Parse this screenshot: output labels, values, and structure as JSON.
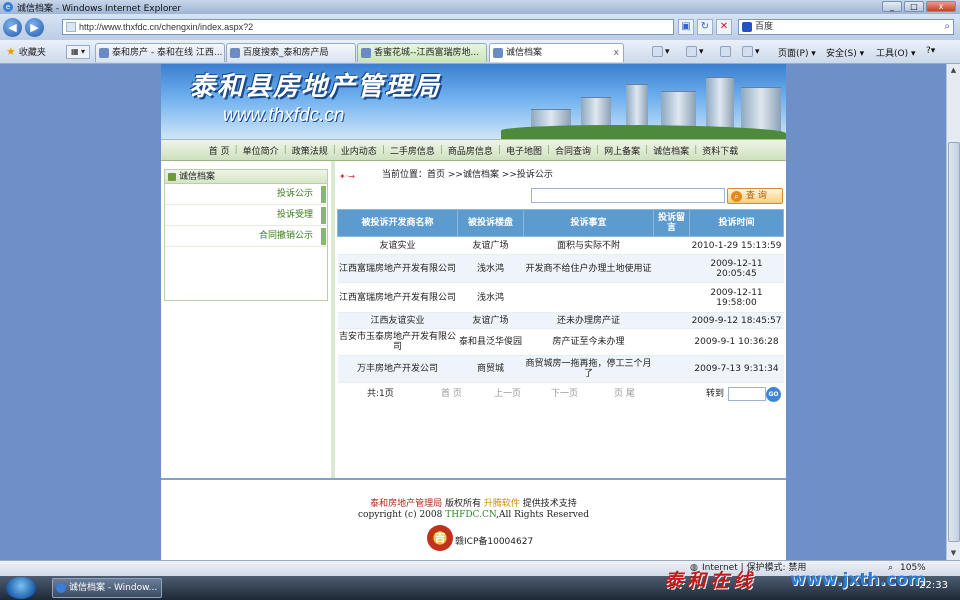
{
  "window": {
    "title": "诚信档案 - Windows Internet Explorer",
    "btn_min": "_",
    "btn_max": "□",
    "btn_close": "x"
  },
  "address_bar": {
    "url": "http://www.thxfdc.cn/chengxin/index.aspx?2",
    "search_text": "百度"
  },
  "favorites": {
    "favorites_label": "收藏夹",
    "tabs": [
      {
        "label": "泰和房产 - 泰和在线 江西..."
      },
      {
        "label": "百度搜索_泰和房产局"
      },
      {
        "label": "香蜜花城--江西富瑞房地..."
      },
      {
        "label": "诚信档案"
      }
    ],
    "commands": {
      "page": "页面(P) ▾",
      "safety": "安全(S) ▾",
      "tools": "工具(O) ▾",
      "help": "?▾"
    }
  },
  "banner": {
    "site_name": "泰和县房地产管理局",
    "site_url": "www.thxfdc.cn"
  },
  "main_nav": [
    "首 页",
    "单位简介",
    "政策法规",
    "业内动态",
    "二手房信息",
    "商品房信息",
    "电子地图",
    "合同查询",
    "网上备案",
    "诚信档案",
    "资料下载"
  ],
  "sidebar": {
    "title": "诚信档案",
    "items": [
      {
        "label": "投诉公示"
      },
      {
        "label": "投诉受理"
      },
      {
        "label": "合同撤销公示"
      }
    ]
  },
  "breadcrumb": {
    "text": "当前位置：首页 >>诚信档案 >>投诉公示"
  },
  "search": {
    "button_label": "查 询"
  },
  "table": {
    "headers": [
      "被投诉开发商名称",
      "被投诉楼盘",
      "投诉事宜",
      "投诉留言",
      "投诉时间"
    ],
    "rows": [
      {
        "developer": "友谊实业",
        "project": "友谊广场",
        "matter": "面积与实际不附",
        "note": "",
        "time": "2010-1-29 15:13:59"
      },
      {
        "developer": "江西富瑞房地产开发有限公司",
        "project": "浅水鸿",
        "matter": "开发商不给住户办理土地使用证",
        "note": "",
        "time": "2009-12-11 20:05:45"
      },
      {
        "developer": "江西富瑞房地产开发有限公司",
        "project": "浅水鸿",
        "matter": "",
        "note": "",
        "time": "2009-12-11 19:58:00"
      },
      {
        "developer": "江西友谊实业",
        "project": "友谊广场",
        "matter": "还未办理房产证",
        "note": "",
        "time": "2009-9-12 18:45:57"
      },
      {
        "developer": "吉安市玉泰房地产开发有限公司",
        "project": "泰和县泛华俊园",
        "matter": "房产证至今未办理",
        "note": "",
        "time": "2009-9-1 10:36:28"
      },
      {
        "developer": "万丰房地产开发公司",
        "project": "商贸城",
        "matter": "商贸城房一拖再拖，停工三个月了",
        "note": "",
        "time": "2009-7-13 9:31:34"
      }
    ]
  },
  "pager": {
    "total": "共:1页",
    "first": "首 页",
    "prev": "上一页",
    "next": "下一页",
    "last": "页 尾",
    "goto": "转到",
    "go": "GO"
  },
  "footer": {
    "owner": "泰和房地产管理局",
    "rights": " 版权所有 ",
    "tech": "升腾软件",
    "support": " 提供技术支持",
    "copyright_pre": "copyright (c) 2008 ",
    "domain": "THFDC.CN",
    "copyright_post": ",All Rights Reserved",
    "icp": "赣ICP备10004627"
  },
  "status_bar": {
    "zone": "Internet | 保护模式: 禁用",
    "zoom": "105%"
  },
  "taskbar": {
    "item": "诚信档案 - Window...",
    "clock": "22:33"
  },
  "watermark": {
    "text1": "泰和在线",
    "text2": "www.jxth.com"
  }
}
